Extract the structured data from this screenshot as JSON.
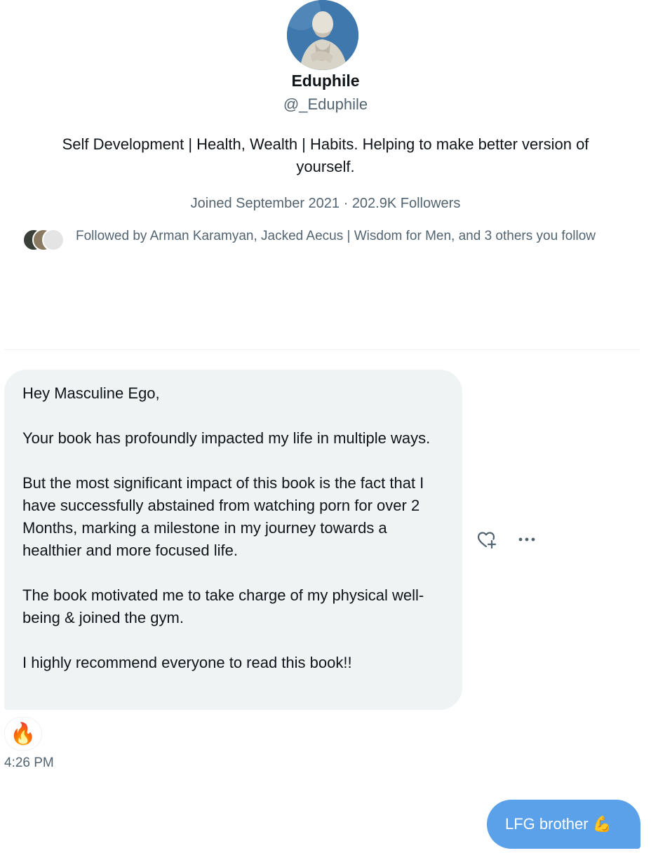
{
  "profile": {
    "display_name": "Eduphile",
    "handle": "@_Eduphile",
    "bio_line1": "Self Development | Health, Wealth | Habits.  Helping to make better version of",
    "bio_line2": "yourself.",
    "joined": "Joined September 2021",
    "separator": " · ",
    "followers": "202.9K Followers",
    "followed_by": "Followed by Arman Karamyan, Jacked Aecus | Wisdom for Men, and 3 others you follow"
  },
  "conversation": {
    "received_message": {
      "paragraphs": [
        "Hey Masculine Ego,",
        "Your book has profoundly impacted my life in multiple ways.",
        "But the most significant impact of this book is the fact that I have successfully abstained from watching porn for over 2 Months, marking a milestone in my journey towards a healthier and more focused life.",
        "The book motivated me to take charge of my physical well-being & joined the gym.",
        "I highly recommend everyone to read this book!!"
      ],
      "reaction_emoji": "🔥",
      "timestamp": "4:26 PM"
    },
    "sent_message": {
      "text": "LFG brother",
      "emoji": "💪"
    }
  },
  "icons": {
    "react": "heart-plus-icon",
    "more": "more-horizontal-icon"
  },
  "colors": {
    "sent_bubble": "#5aa1ea",
    "received_bubble": "#eff3f4",
    "secondary_text": "#536471",
    "accent": "#1d9bf0"
  }
}
